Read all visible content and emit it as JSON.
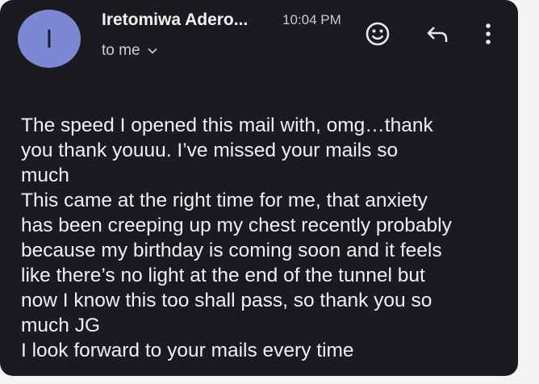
{
  "email": {
    "avatar_letter": "I",
    "sender": "Iretomiwa Adero...",
    "time": "10:04 PM",
    "recipient_label": "to me",
    "body_lines": [
      "The speed I opened this mail with, omg…thank",
      "you thank youuu. I’ve missed your mails so",
      "much",
      "This came at the right time for me, that anxiety",
      "has been creeping up my chest recently probably",
      "because my birthday is coming soon and it feels",
      "like there’s no light at the end of the tunnel but",
      "now I know this too shall pass, so thank you so",
      "much JG",
      "I look forward to your mails every time"
    ]
  },
  "toolbar": {
    "icons": [
      "emoji-icon",
      "reply-icon",
      "more-vert-icon"
    ]
  },
  "colors": {
    "background": "#1a1b1f",
    "avatar": "#7b88d4",
    "text": "#f0f0f0"
  }
}
